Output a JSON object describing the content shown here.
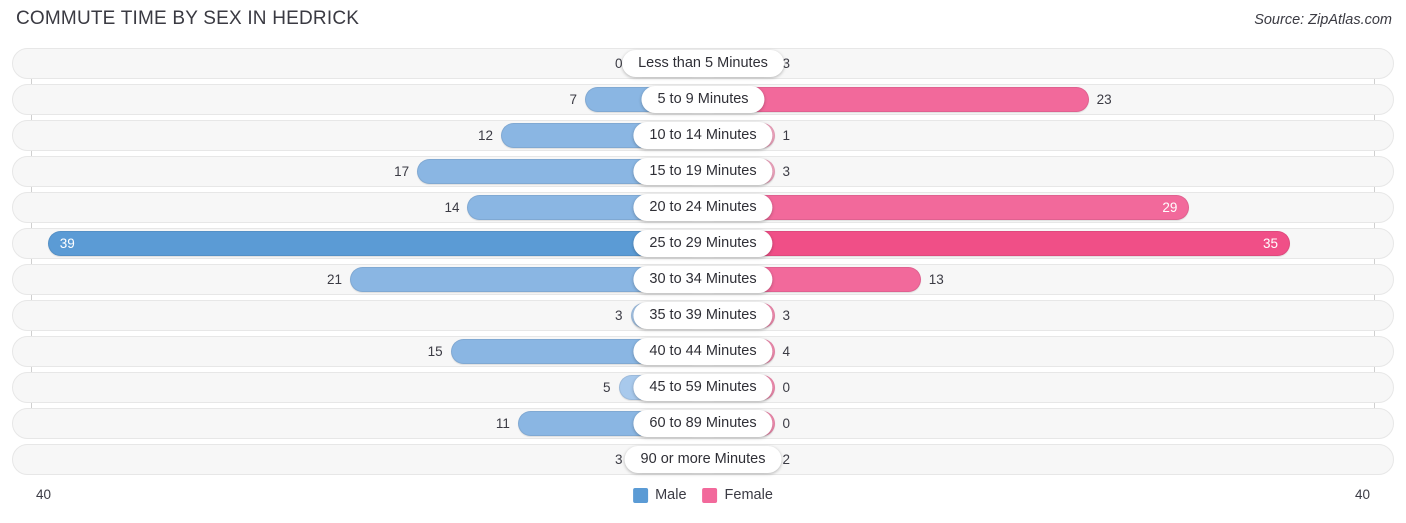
{
  "header": {
    "title": "COMMUTE TIME BY SEX IN HEDRICK",
    "source": "Source: ZipAtlas.com"
  },
  "axis": {
    "left_tick": "40",
    "right_tick": "40"
  },
  "legend": {
    "male_label": "Male",
    "female_label": "Female",
    "male_color": "#5b9bd5",
    "female_color": "#f2699b"
  },
  "colors": {
    "male_light": "#a8c9ec",
    "male_mid": "#8ab6e3",
    "male_strong": "#5b9bd5",
    "female_light": "#f7a9c4",
    "female_mid": "#f78fb3",
    "female_strong": "#f2699b",
    "female_max": "#f04f87",
    "track": "#f7f7f7"
  },
  "chart_data": {
    "type": "bar",
    "subtype": "diverging-bar",
    "title": "COMMUTE TIME BY SEX IN HEDRICK",
    "xlabel": "",
    "ylabel": "",
    "xlim": [
      -40,
      40
    ],
    "axis_max": 40,
    "grid": false,
    "legend_position": "bottom-center",
    "categories": [
      "Less than 5 Minutes",
      "5 to 9 Minutes",
      "10 to 14 Minutes",
      "15 to 19 Minutes",
      "20 to 24 Minutes",
      "25 to 29 Minutes",
      "30 to 34 Minutes",
      "35 to 39 Minutes",
      "40 to 44 Minutes",
      "45 to 59 Minutes",
      "60 to 89 Minutes",
      "90 or more Minutes"
    ],
    "series": [
      {
        "name": "Male",
        "values": [
          0,
          7,
          12,
          17,
          14,
          39,
          21,
          3,
          15,
          5,
          11,
          3
        ]
      },
      {
        "name": "Female",
        "values": [
          3,
          23,
          1,
          3,
          29,
          35,
          13,
          3,
          4,
          0,
          0,
          2
        ]
      }
    ]
  },
  "rows": [
    {
      "category": "Less than 5 Minutes",
      "male": "0",
      "female": "3",
      "male_val": 0,
      "female_val": 3,
      "male_color": "#a8c9ec",
      "female_color": "#f78fb3",
      "male_inside": false,
      "female_inside": false
    },
    {
      "category": "5 to 9 Minutes",
      "male": "7",
      "female": "23",
      "male_val": 7,
      "female_val": 23,
      "male_color": "#8ab6e3",
      "female_color": "#f2699b",
      "male_inside": false,
      "female_inside": false
    },
    {
      "category": "10 to 14 Minutes",
      "male": "12",
      "female": "1",
      "male_val": 12,
      "female_val": 1,
      "male_color": "#8ab6e3",
      "female_color": "#f7a9c4",
      "male_inside": false,
      "female_inside": false
    },
    {
      "category": "15 to 19 Minutes",
      "male": "17",
      "female": "3",
      "male_val": 17,
      "female_val": 3,
      "male_color": "#8ab6e3",
      "female_color": "#f7a9c4",
      "male_inside": false,
      "female_inside": false
    },
    {
      "category": "20 to 24 Minutes",
      "male": "14",
      "female": "29",
      "male_val": 14,
      "female_val": 29,
      "male_color": "#8ab6e3",
      "female_color": "#f2699b",
      "male_inside": false,
      "female_inside": true
    },
    {
      "category": "25 to 29 Minutes",
      "male": "39",
      "female": "35",
      "male_val": 39,
      "female_val": 35,
      "male_color": "#5b9bd5",
      "female_color": "#f04f87",
      "male_inside": true,
      "female_inside": true
    },
    {
      "category": "30 to 34 Minutes",
      "male": "21",
      "female": "13",
      "male_val": 21,
      "female_val": 13,
      "male_color": "#8ab6e3",
      "female_color": "#f2699b",
      "male_inside": false,
      "female_inside": false
    },
    {
      "category": "35 to 39 Minutes",
      "male": "3",
      "female": "3",
      "male_val": 3,
      "female_val": 3,
      "male_color": "#a8c9ec",
      "female_color": "#f78fb3",
      "male_inside": false,
      "female_inside": false
    },
    {
      "category": "40 to 44 Minutes",
      "male": "15",
      "female": "4",
      "male_val": 15,
      "female_val": 4,
      "male_color": "#8ab6e3",
      "female_color": "#f78fb3",
      "male_inside": false,
      "female_inside": false
    },
    {
      "category": "45 to 59 Minutes",
      "male": "5",
      "female": "0",
      "male_val": 5,
      "female_val": 0,
      "male_color": "#a8c9ec",
      "female_color": "#f78fb3",
      "male_inside": false,
      "female_inside": false
    },
    {
      "category": "60 to 89 Minutes",
      "male": "11",
      "female": "0",
      "male_val": 11,
      "female_val": 0,
      "male_color": "#8ab6e3",
      "female_color": "#f78fb3",
      "male_inside": false,
      "female_inside": false
    },
    {
      "category": "90 or more Minutes",
      "male": "3",
      "female": "2",
      "male_val": 3,
      "female_val": 2,
      "male_color": "#a8c9ec",
      "female_color": "#f78fb3",
      "male_inside": false,
      "female_inside": false
    }
  ]
}
